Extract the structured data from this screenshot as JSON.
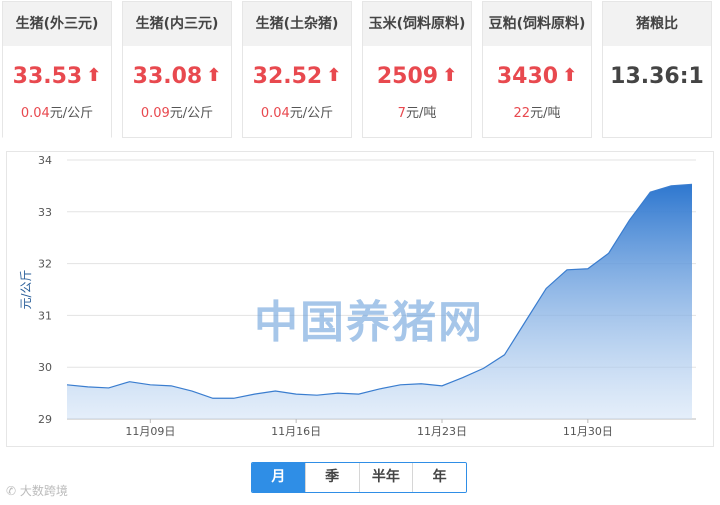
{
  "cards": [
    {
      "name": "生猪(外三元)",
      "price": "33.53",
      "arrow": "⬆",
      "change_value": "0.04",
      "change_unit": "元/公斤"
    },
    {
      "name": "生猪(内三元)",
      "price": "33.08",
      "arrow": "⬆",
      "change_value": "0.09",
      "change_unit": "元/公斤"
    },
    {
      "name": "生猪(土杂猪)",
      "price": "32.52",
      "arrow": "⬆",
      "change_value": "0.04",
      "change_unit": "元/公斤"
    },
    {
      "name": "玉米(饲料原料)",
      "price": "2509",
      "arrow": "⬆",
      "change_value": "7",
      "change_unit": "元/吨"
    },
    {
      "name": "豆粕(饲料原料)",
      "price": "3430",
      "arrow": "⬆",
      "change_value": "22",
      "change_unit": "元/吨"
    },
    {
      "name": "猪粮比",
      "price": "13.36:1"
    }
  ],
  "watermark": "中国养猪网",
  "range_tabs": [
    {
      "label": "月",
      "active": true
    },
    {
      "label": "季",
      "active": false
    },
    {
      "label": "半年",
      "active": false
    },
    {
      "label": "年",
      "active": false
    }
  ],
  "source_mark": "大数跨境",
  "colors": {
    "up": "#e8494f",
    "accent": "#2f8ee6",
    "line": "#3a7dcf"
  },
  "chart_data": {
    "type": "area",
    "title": "",
    "xlabel": "",
    "ylabel": "元/公斤",
    "ylim": [
      29,
      34
    ],
    "yticks": [
      29,
      30,
      31,
      32,
      33,
      34
    ],
    "x_tick_labels": [
      "11月09日",
      "11月16日",
      "11月23日",
      "11月30日"
    ],
    "x_tick_index": [
      4,
      11,
      18,
      25
    ],
    "grid": true,
    "series": [
      {
        "values": [
          29.66,
          29.62,
          29.6,
          29.72,
          29.66,
          29.64,
          29.54,
          29.4,
          29.4,
          29.48,
          29.54,
          29.48,
          29.46,
          29.5,
          29.48,
          29.58,
          29.66,
          29.68,
          29.64,
          29.8,
          29.98,
          30.24,
          30.88,
          31.52,
          31.88,
          31.9,
          32.2,
          32.84,
          33.38,
          33.5,
          33.53
        ]
      }
    ]
  }
}
